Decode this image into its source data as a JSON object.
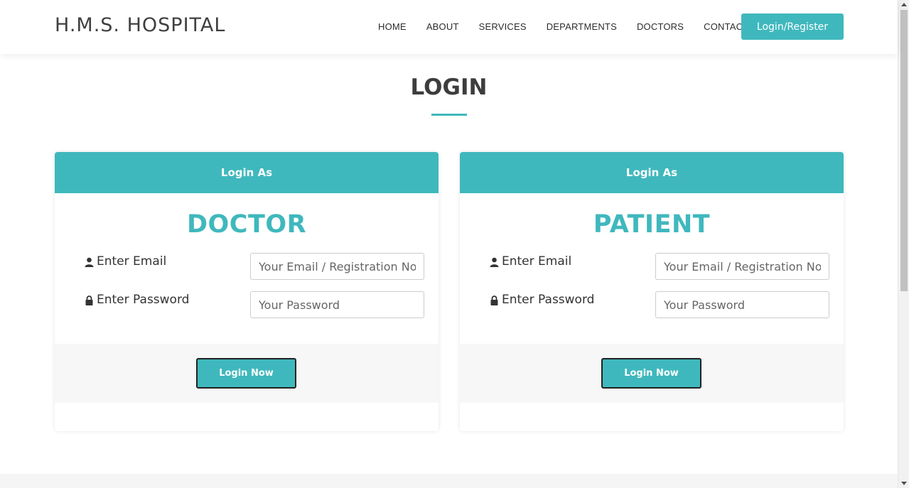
{
  "header": {
    "logo": "H.M.S. HOSPITAL",
    "nav": [
      "HOME",
      "ABOUT",
      "SERVICES",
      "DEPARTMENTS",
      "DOCTORS",
      "CONTACT"
    ],
    "cta_label": "Login/Register"
  },
  "page": {
    "title": "LOGIN"
  },
  "cards": [
    {
      "header": "Login As",
      "role": "DOCTOR",
      "email_label": "Enter Email",
      "email_placeholder": "Your Email / Registration No.",
      "password_label": "Enter Password",
      "password_placeholder": "Your Password",
      "button_label": "Login Now"
    },
    {
      "header": "Login As",
      "role": "PATIENT",
      "email_label": "Enter Email",
      "email_placeholder": "Your Email / Registration No.",
      "password_label": "Enter Password",
      "password_placeholder": "Your Password",
      "button_label": "Login Now"
    }
  ],
  "colors": {
    "accent": "#3fb8bd",
    "text_dark": "#3d3d3d"
  },
  "icons": {
    "email": "user-icon",
    "password": "lock-icon"
  }
}
